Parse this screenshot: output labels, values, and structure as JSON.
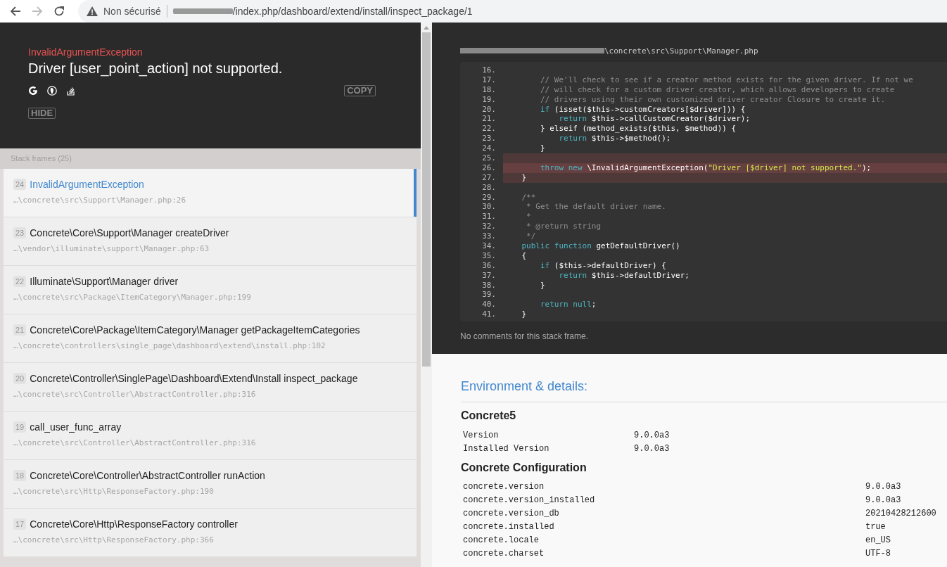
{
  "browser": {
    "security_label": "Non sécurisé",
    "url": "/index.php/dashboard/extend/install/inspect_package/1"
  },
  "exception": {
    "type": "InvalidArgumentException",
    "message": "Driver [user_point_action] not supported.",
    "copy_button": "COPY",
    "hide_button": "HIDE"
  },
  "stack_frames": {
    "title": "Stack frames (25)",
    "frames": [
      {
        "index": "24",
        "name": "InvalidArgumentException",
        "file": "…\\concrete\\src\\Support\\Manager.php:26",
        "selected": true
      },
      {
        "index": "23",
        "name": "Concrete\\Core\\Support\\Manager createDriver",
        "file": "…\\vendor\\illuminate\\support\\Manager.php:63",
        "selected": false
      },
      {
        "index": "22",
        "name": "Illuminate\\Support\\Manager driver",
        "file": "…\\concrete\\src\\Package\\ItemCategory\\Manager.php:199",
        "selected": false
      },
      {
        "index": "21",
        "name": "Concrete\\Core\\Package\\ItemCategory\\Manager getPackageItemCategories",
        "file": "…\\concrete\\controllers\\single_page\\dashboard\\extend\\install.php:102",
        "selected": false
      },
      {
        "index": "20",
        "name": "Concrete\\Controller\\SinglePage\\Dashboard\\Extend\\Install inspect_package",
        "file": "…\\concrete\\src\\Controller\\AbstractController.php:316",
        "selected": false
      },
      {
        "index": "19",
        "name": "call_user_func_array",
        "file": "…\\concrete\\src\\Controller\\AbstractController.php:316",
        "selected": false
      },
      {
        "index": "18",
        "name": "Concrete\\Core\\Controller\\AbstractController runAction",
        "file": "…\\concrete\\src\\Http\\ResponseFactory.php:190",
        "selected": false
      },
      {
        "index": "17",
        "name": "Concrete\\Core\\Http\\ResponseFactory controller",
        "file": "…\\concrete\\src\\Http\\ResponseFactory.php:366",
        "selected": false
      }
    ]
  },
  "code": {
    "file": "\\concrete\\src\\Support\\Manager.php",
    "lines": [
      {
        "number": "16.",
        "highlighted": false,
        "current": false
      },
      {
        "number": "17.",
        "highlighted": false,
        "current": false,
        "tokens": [
          {
            "kind": "comment",
            "text": "        // We'll check to see if a creator method exists for the given driver. If not we"
          }
        ]
      },
      {
        "number": "18.",
        "highlighted": false,
        "current": false,
        "tokens": [
          {
            "kind": "comment",
            "text": "        // will check for a custom driver creator, which allows developers to create"
          }
        ]
      },
      {
        "number": "19.",
        "highlighted": false,
        "current": false,
        "tokens": [
          {
            "kind": "comment",
            "text": "        // drivers using their own customized driver creator Closure to create it."
          }
        ]
      },
      {
        "number": "20.",
        "highlighted": false,
        "current": false,
        "tokens": [
          {
            "kind": "keyword",
            "text": "        if"
          },
          {
            "kind": "plain",
            "text": " (isset($this->customCreators[$driver])) {"
          }
        ]
      },
      {
        "number": "21.",
        "highlighted": false,
        "current": false,
        "tokens": [
          {
            "kind": "keyword",
            "text": "            return"
          },
          {
            "kind": "plain",
            "text": " $this->callCustomCreator($driver);"
          }
        ]
      },
      {
        "number": "22.",
        "highlighted": false,
        "current": false,
        "tokens": [
          {
            "kind": "plain",
            "text": "        } elseif (method_exists($this, $method)) {"
          }
        ]
      },
      {
        "number": "23.",
        "highlighted": false,
        "current": false,
        "tokens": [
          {
            "kind": "keyword",
            "text": "            return"
          },
          {
            "kind": "plain",
            "text": " $this->$method();"
          }
        ]
      },
      {
        "number": "24.",
        "highlighted": false,
        "current": false,
        "tokens": [
          {
            "kind": "plain",
            "text": "        }"
          }
        ]
      },
      {
        "number": "25.",
        "highlighted": true,
        "current": false
      },
      {
        "number": "26.",
        "highlighted": true,
        "current": true,
        "tokens": [
          {
            "kind": "keyword",
            "text": "        throw new"
          },
          {
            "kind": "plain",
            "text": " \\InvalidArgumentException("
          },
          {
            "kind": "string",
            "text": "\"Driver [$driver] not supported.\""
          },
          {
            "kind": "plain",
            "text": ");"
          }
        ]
      },
      {
        "number": "27.",
        "highlighted": true,
        "current": false,
        "tokens": [
          {
            "kind": "plain",
            "text": "    }"
          }
        ]
      },
      {
        "number": "28.",
        "highlighted": false,
        "current": false
      },
      {
        "number": "29.",
        "highlighted": false,
        "current": false,
        "tokens": [
          {
            "kind": "comment",
            "text": "    /**"
          }
        ]
      },
      {
        "number": "30.",
        "highlighted": false,
        "current": false,
        "tokens": [
          {
            "kind": "comment",
            "text": "     * Get the default driver name."
          }
        ]
      },
      {
        "number": "31.",
        "highlighted": false,
        "current": false,
        "tokens": [
          {
            "kind": "comment",
            "text": "     *"
          }
        ]
      },
      {
        "number": "32.",
        "highlighted": false,
        "current": false,
        "tokens": [
          {
            "kind": "comment",
            "text": "     * @return string"
          }
        ]
      },
      {
        "number": "33.",
        "highlighted": false,
        "current": false,
        "tokens": [
          {
            "kind": "comment",
            "text": "     */"
          }
        ]
      },
      {
        "number": "34.",
        "highlighted": false,
        "current": false,
        "tokens": [
          {
            "kind": "keyword",
            "text": "    public function"
          },
          {
            "kind": "plain",
            "text": " getDefaultDriver()"
          }
        ]
      },
      {
        "number": "35.",
        "highlighted": false,
        "current": false,
        "tokens": [
          {
            "kind": "plain",
            "text": "    {"
          }
        ]
      },
      {
        "number": "36.",
        "highlighted": false,
        "current": false,
        "tokens": [
          {
            "kind": "keyword",
            "text": "        if"
          },
          {
            "kind": "plain",
            "text": " ($this->defaultDriver) {"
          }
        ]
      },
      {
        "number": "37.",
        "highlighted": false,
        "current": false,
        "tokens": [
          {
            "kind": "keyword",
            "text": "            return"
          },
          {
            "kind": "plain",
            "text": " $this->defaultDriver;"
          }
        ]
      },
      {
        "number": "38.",
        "highlighted": false,
        "current": false,
        "tokens": [
          {
            "kind": "plain",
            "text": "        }"
          }
        ]
      },
      {
        "number": "39.",
        "highlighted": false,
        "current": false
      },
      {
        "number": "40.",
        "highlighted": false,
        "current": false,
        "tokens": [
          {
            "kind": "keyword",
            "text": "        return null"
          },
          {
            "kind": "plain",
            "text": ";"
          }
        ]
      },
      {
        "number": "41.",
        "highlighted": false,
        "current": false,
        "tokens": [
          {
            "kind": "plain",
            "text": "    }"
          }
        ]
      }
    ],
    "comments": "No comments for this stack frame."
  },
  "details": {
    "title": "Environment & details:",
    "sections": [
      {
        "title": "Concrete5",
        "rows": [
          {
            "key": "Version",
            "value": "9.0.0a3"
          },
          {
            "key": "Installed Version",
            "value": "9.0.0a3"
          }
        ]
      },
      {
        "title": "Concrete Configuration",
        "rows": [
          {
            "key": "concrete.version",
            "value": "9.0.0a3"
          },
          {
            "key": "concrete.version_installed",
            "value": "9.0.0a3"
          },
          {
            "key": "concrete.version_db",
            "value": "20210428212600"
          },
          {
            "key": "concrete.installed",
            "value": "true"
          },
          {
            "key": "concrete.locale",
            "value": "en_US"
          },
          {
            "key": "concrete.charset",
            "value": "UTF-8"
          }
        ]
      }
    ]
  }
}
